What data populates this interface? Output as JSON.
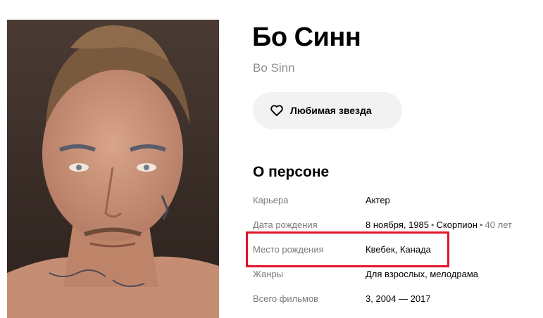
{
  "person": {
    "name": "Бо Синн",
    "original_name": "Bo Sinn"
  },
  "favorite_button": {
    "label": "Любимая звезда",
    "icon": "heart-outline-icon"
  },
  "about": {
    "title": "О персоне",
    "rows": [
      {
        "key": "Карьера",
        "value": "Актер"
      },
      {
        "key": "Дата рождения",
        "date": "8 ноября, 1985",
        "sign": "Скорпион",
        "age": "40 лет"
      },
      {
        "key": "Место рождения",
        "city": "Квебек",
        "country": "Канада"
      },
      {
        "key": "Жанры",
        "value": "Для взрослых, мелодрама"
      },
      {
        "key": "Всего фильмов",
        "count": "3",
        "years": "2004 — 2017"
      }
    ]
  },
  "highlight": {
    "color": "#e3132a",
    "target_row": "Место рождения"
  },
  "photo": {
    "alt": "Бо Синн"
  }
}
